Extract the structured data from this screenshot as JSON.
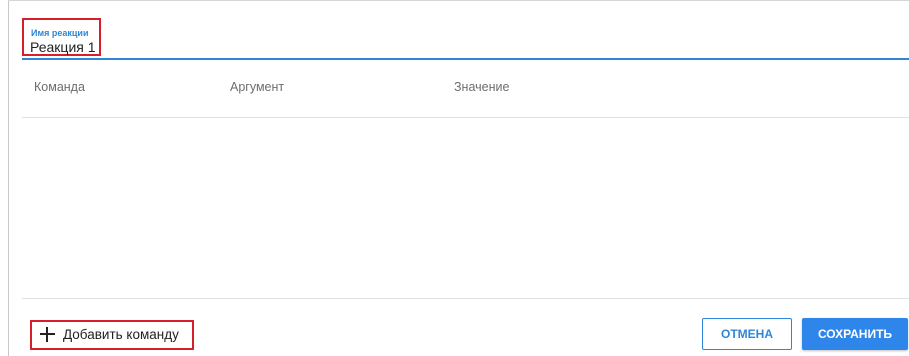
{
  "form": {
    "name_label": "Имя реакции",
    "name_value": "Реакция 1"
  },
  "table": {
    "columns": [
      "Команда",
      "Аргумент",
      "Значение"
    ],
    "rows": []
  },
  "footer": {
    "add_command_label": "Добавить команду",
    "cancel_label": "ОТМЕНА",
    "save_label": "СОХРАНИТЬ"
  },
  "colors": {
    "accent": "#2f86d6",
    "primary_button": "#2f86ea",
    "highlight_border": "#d61f2b",
    "text": "#222222",
    "muted_text": "#6d6d6d"
  },
  "icons": {
    "add": "plus-icon"
  }
}
